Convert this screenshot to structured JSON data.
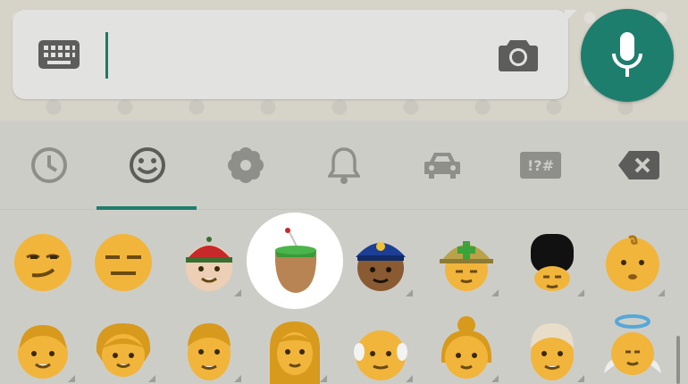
{
  "composer": {
    "text": "",
    "keyboard_icon": "keyboard-icon",
    "camera_icon": "camera-icon",
    "mic_icon": "mic-icon",
    "accent": "#1e7e6d"
  },
  "tabs": {
    "active": "smileys",
    "items": [
      {
        "id": "recent",
        "icon": "clock-icon"
      },
      {
        "id": "smileys",
        "icon": "smiley-icon"
      },
      {
        "id": "nature",
        "icon": "flower-icon"
      },
      {
        "id": "objects",
        "icon": "bell-icon"
      },
      {
        "id": "places",
        "icon": "car-icon"
      },
      {
        "id": "symbols",
        "icon": "symbols-icon",
        "label": "!?#"
      },
      {
        "id": "backspace",
        "icon": "backspace-icon"
      }
    ]
  },
  "emoji_rows": [
    [
      "smirking-face",
      "expressionless-face",
      "man-with-cap",
      "mate-drink",
      "police-officer",
      "rescue-worker-helmet",
      "guardsman",
      "baby"
    ],
    [
      "boy",
      "girl",
      "man",
      "woman",
      "older-man",
      "older-woman",
      "man-light-hair",
      "angel"
    ]
  ],
  "highlighted_emoji": "mate-drink"
}
